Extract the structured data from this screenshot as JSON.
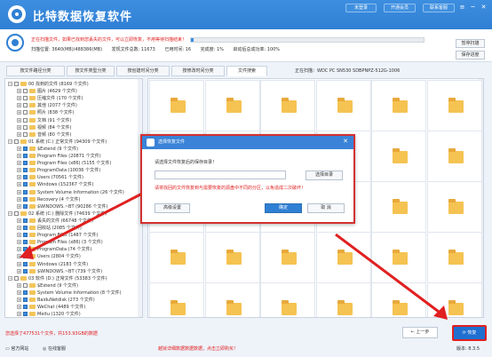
{
  "window": {
    "title": "比特数据恢复软件",
    "buttons": [
      "未登录",
      "开通会员",
      "联系客服"
    ],
    "controls": [
      "≡",
      "─",
      "✕"
    ]
  },
  "scan": {
    "warning": "正在扫描文件，如果已找到您丢失的文件，可以立即恢复，不用等待扫描结束！",
    "progress_percent": 1,
    "stats": [
      "扫描位置: 3640(MB)/488386(MB)",
      "发现文件总数: 11673",
      "已用时间: 16",
      "完成度: 1%",
      "启动后总成功率: 100%"
    ],
    "pause_label": "暂停扫描",
    "save_label": "保存进度"
  },
  "tabs": [
    {
      "label": "按文件路径分类"
    },
    {
      "label": "按文件类型分类"
    },
    {
      "label": "按创建时间分类"
    },
    {
      "label": "按修改时间分类"
    },
    {
      "label": "文件搜索"
    }
  ],
  "device_label": "正在扫描：WDC PC SN530 SDBPNPZ-512G-1006",
  "tree": [
    {
      "label": "00 找到的文件 (8169 个文件)"
    },
    {
      "label": "图片 (4629 个文件)"
    },
    {
      "label": "压缩文件 (170 个文件)"
    },
    {
      "label": "其他 (2077 个文件)"
    },
    {
      "label": "照片 (838 个文件)"
    },
    {
      "label": "文档 (91 个文件)"
    },
    {
      "label": "视频 (84 个文件)"
    },
    {
      "label": "音频 (80 个文件)"
    },
    {
      "label": "01 系统 (C:) 正常文件 (94309 个文件)"
    },
    {
      "label": "$Extend (9 个文件)"
    },
    {
      "label": "Program Files (20871 个文件)"
    },
    {
      "label": "Program Files (x86) (5155 个文件)"
    },
    {
      "label": "ProgramData (10036 个文件)"
    },
    {
      "label": "Users (70561 个文件)"
    },
    {
      "label": "Windows (152367 个文件)"
    },
    {
      "label": "System Volume Information (26 个文件)"
    },
    {
      "label": "Recovery (4 个文件)"
    },
    {
      "label": "$WINDOWS.~BT (90286 个文件)"
    },
    {
      "label": "02 系统 (C:) 删除文件 (74639 个文件)"
    },
    {
      "label": "丢失的文件 (66748 个文件)"
    },
    {
      "label": "回收站 (2085 个文件)"
    },
    {
      "label": "Program Files (1487 个文件)"
    },
    {
      "label": "Program Files (x86) (3 个文件)"
    },
    {
      "label": "ProgramData (74 个文件)"
    },
    {
      "label": "Users (2804 个文件)"
    },
    {
      "label": "Windows (2183 个文件)"
    },
    {
      "label": "$WINDOWS.~BT (739 个文件)"
    },
    {
      "label": "03 软件 (D:) 正常文件 (53383 个文件)"
    },
    {
      "label": "$Extend (9 个文件)"
    },
    {
      "label": "System Volume Information (8 个文件)"
    },
    {
      "label": "BaiduNetdisk (273 个文件)"
    },
    {
      "label": "WeChat (4489 个文件)"
    },
    {
      "label": "Meitu (1320 个文件)"
    }
  ],
  "grid": [
    {
      "label": ""
    },
    {
      "label": ""
    },
    {
      "label": ""
    },
    {
      "label": ""
    },
    {
      "label": ""
    },
    {
      "label": ""
    },
    {
      "label": ""
    },
    {
      "label": ""
    },
    {
      "label": ""
    },
    {
      "label": ""
    },
    {
      "label": "Adobe Acrobat (2..."
    },
    {
      "label": "Adobe Photoshop ..."
    },
    {
      "label": ""
    },
    {
      "label": ""
    },
    {
      "label": ""
    },
    {
      "label": ""
    },
    {
      "label": "BcutBilibili (683 ..."
    },
    {
      "label": "bilibili (79 个文件)"
    },
    {
      "label": "Clash.for.Window..."
    },
    {
      "label": "CloudMusic (169 ..."
    },
    {
      "label": "EaseUS (1065 个..."
    },
    {
      "label": "Everything (9 个..."
    },
    {
      "label": "Macbz软件 (25 个..."
    },
    {
      "label": "Meitu (1320 个文件)"
    },
    {
      "label": ""
    },
    {
      "label": ""
    },
    {
      "label": ""
    },
    {
      "label": ""
    },
    {
      "label": ""
    },
    {
      "label": ""
    }
  ],
  "bottom": {
    "selection_info": "您选择了477531个文件，共153.93GB的数据",
    "prev_label": "上一步",
    "recover_label": "恢复",
    "website": "官方网站",
    "consult": "在线客服",
    "notice": "越狱详细数据数据数据，点击立即购买！",
    "version": "版本: 8.3.5"
  },
  "dialog": {
    "title": "选择恢复文件",
    "prompt": "请选择文件恢复后的保存目录！",
    "path_value": "",
    "browse_label": "选择目录",
    "warning": "请将找回的文件恢复到与需要恢复的源盘中不同的分区，以免造成二次破坏！",
    "advanced_label": "高级设置",
    "ok_label": "确定",
    "cancel_label": "取 消"
  }
}
